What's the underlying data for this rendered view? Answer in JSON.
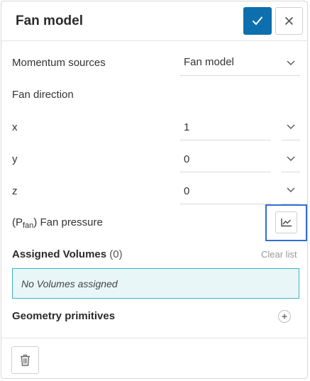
{
  "header": {
    "title": "Fan model",
    "confirm_icon": "check-icon",
    "close_icon": "close-icon"
  },
  "momentum": {
    "label": "Momentum sources",
    "value": "Fan model"
  },
  "direction": {
    "label": "Fan direction",
    "x": {
      "label": "x",
      "value": "1"
    },
    "y": {
      "label": "y",
      "value": "0"
    },
    "z": {
      "label": "z",
      "value": "0"
    }
  },
  "fan_pressure": {
    "prefix": "(P",
    "subscript": "fan",
    "suffix": ") Fan pressure",
    "button_icon": "chart-icon"
  },
  "assigned": {
    "title": "Assigned Volumes",
    "count": "(0)",
    "clear_label": "Clear list",
    "empty_text": "No Volumes assigned"
  },
  "geometry": {
    "title": "Geometry primitives",
    "add_icon": "plus-icon"
  },
  "footer": {
    "delete_icon": "trash-icon"
  },
  "colors": {
    "primary": "#0d6fae",
    "highlight_border": "#2f6fd6",
    "empty_bg": "#e8f6f8",
    "empty_border": "#3bb3c3"
  }
}
